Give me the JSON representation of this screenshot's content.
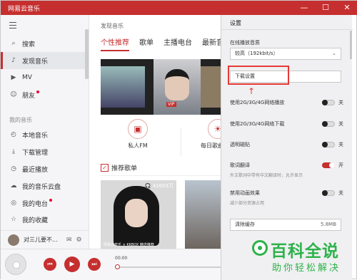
{
  "window": {
    "title": "网易云音乐",
    "minimize": "—",
    "maximize": "☐",
    "close": "✕"
  },
  "sidebar": {
    "items": [
      {
        "label": "搜索",
        "icon": "search-icon",
        "glyph": "⌕"
      },
      {
        "label": "发现音乐",
        "icon": "music-note-icon",
        "glyph": "♪"
      },
      {
        "label": "MV",
        "icon": "video-icon",
        "glyph": "▶"
      },
      {
        "label": "朋友",
        "icon": "friends-icon",
        "glyph": "☺"
      }
    ],
    "section_title": "我的音乐",
    "my_music": [
      {
        "label": "本地音乐",
        "icon": "local-music-icon",
        "glyph": "◴"
      },
      {
        "label": "下载管理",
        "icon": "download-icon",
        "glyph": "⤓"
      },
      {
        "label": "最近播放",
        "icon": "recent-icon",
        "glyph": "◷"
      },
      {
        "label": "我的音乐云盘",
        "icon": "cloud-icon",
        "glyph": "☁"
      },
      {
        "label": "我的电台",
        "icon": "radio-icon",
        "glyph": "◎"
      },
      {
        "label": "我的收藏",
        "icon": "collection-icon",
        "glyph": "☆"
      }
    ],
    "user": {
      "name": "对三儿要不...",
      "mail_icon": "✉",
      "settings_icon": "⚙"
    }
  },
  "main": {
    "breadcrumb": "发现音乐",
    "tabs": [
      "个性推荐",
      "歌单",
      "主播电台",
      "最新音乐"
    ],
    "banner_tag": "VIP",
    "fm": [
      {
        "label": "私人FM",
        "glyph": "▣"
      },
      {
        "label": "每日歌曲推荐",
        "glyph": "☀"
      }
    ],
    "recommend_title": "推荐歌单",
    "recommend_check": "✓",
    "cover1": {
      "plays": "🎧 41603万",
      "brand": "网易云音乐 × KKBOX 精选推荐"
    }
  },
  "settings": {
    "title": "设置",
    "quality_label": "在线播放音质",
    "quality_value": "较高（192kbit/s）",
    "quality_arrow": "⌄",
    "download_settings": "下载设置",
    "options": [
      {
        "label": "使用2G/3G/4G网络播放",
        "state": "关",
        "on": false
      },
      {
        "label": "使用2G/3G/4G网络下载",
        "state": "关",
        "on": false
      },
      {
        "label": "透明磁贴",
        "state": "关",
        "on": false
      },
      {
        "label": "歌词翻译",
        "state": "开",
        "on": true,
        "hint": "外文歌词中带有中文翻译时，允许显示"
      },
      {
        "label": "禁用动画效果",
        "state": "关",
        "on": false,
        "hint": "减少部分资源占用"
      }
    ],
    "clear_cache": "清除缓存",
    "cache_size": "5.8MB"
  },
  "player": {
    "prev": "⏮",
    "play": "▶",
    "next": "⏭",
    "time": "00:00"
  },
  "watermark": {
    "big": "百科全说",
    "small": "助你轻松解决"
  },
  "colors": {
    "accent": "#c62f2f",
    "highlight": "#e53935",
    "watermark": "#2db24a"
  }
}
